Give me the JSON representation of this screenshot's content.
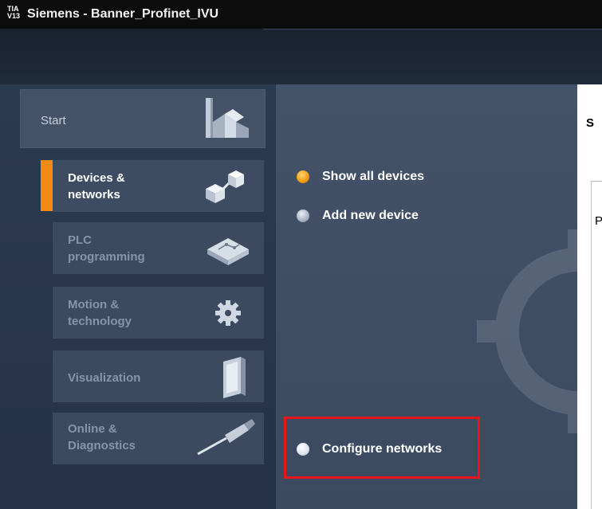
{
  "window": {
    "logo_text": "TIA V13",
    "title": "Siemens  -  Banner_Profinet_IVU"
  },
  "start": {
    "label": "Start"
  },
  "nav": {
    "items": [
      {
        "line1": "Devices &",
        "line2": "networks",
        "icon": "devices-networks-icon",
        "active": true
      },
      {
        "line1": "PLC",
        "line2": "programming",
        "icon": "plc-programming-icon",
        "active": false
      },
      {
        "line1": "Motion &",
        "line2": "technology",
        "icon": "gear-icon",
        "active": false
      },
      {
        "line1": "Visualization",
        "line2": "",
        "icon": "hmi-panel-icon",
        "active": false
      },
      {
        "line1": "Online &",
        "line2": "Diagnostics",
        "icon": "probe-icon",
        "active": false
      }
    ]
  },
  "actions": {
    "show_all_devices": "Show all devices",
    "add_new_device": "Add new device",
    "configure_networks": "Configure networks"
  },
  "right_panel": {
    "header_text": "S",
    "list_text": "P"
  },
  "colors": {
    "accent": "#f28a16",
    "highlight": "#e8141a",
    "background": "#28364b"
  }
}
